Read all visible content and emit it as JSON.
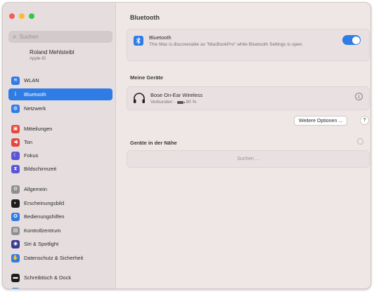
{
  "sidebar": {
    "search_placeholder": "Suchen",
    "account": {
      "name": "Roland Mehlsteibl",
      "subtitle": "Apple-ID"
    },
    "items": [
      {
        "label": "WLAN",
        "icon": "wifi-icon",
        "color": "#2f7ce6",
        "glyph": "≋"
      },
      {
        "label": "Bluetooth",
        "icon": "bluetooth-icon",
        "color": "#2f7ce6",
        "glyph": "ᛒ",
        "active": true
      },
      {
        "label": "Netzwerk",
        "icon": "globe-icon",
        "color": "#2f7ce6",
        "glyph": "◍"
      },
      {
        "label": "Mitteilungen",
        "icon": "bell-icon",
        "color": "#e5483f",
        "glyph": "▣"
      },
      {
        "label": "Ton",
        "icon": "speaker-icon",
        "color": "#e5483f",
        "glyph": "◀"
      },
      {
        "label": "Fokus",
        "icon": "moon-icon",
        "color": "#5b55d6",
        "glyph": "☾"
      },
      {
        "label": "Bildschirmzeit",
        "icon": "hourglass-icon",
        "color": "#5b55d6",
        "glyph": "⧗"
      },
      {
        "label": "Allgemein",
        "icon": "gear-icon",
        "color": "#8e8e93",
        "glyph": "⚙"
      },
      {
        "label": "Erscheinungsbild",
        "icon": "appearance-icon",
        "color": "#1c1c1e",
        "glyph": "◐"
      },
      {
        "label": "Bedienungshilfen",
        "icon": "accessibility-icon",
        "color": "#2f7ce6",
        "glyph": "✪"
      },
      {
        "label": "Kontrollzentrum",
        "icon": "control-center-icon",
        "color": "#8e8e93",
        "glyph": "▤"
      },
      {
        "label": "Siri & Spotlight",
        "icon": "siri-icon",
        "color": "#3b3b8f",
        "glyph": "◉"
      },
      {
        "label": "Datenschutz & Sicherheit",
        "icon": "hand-icon",
        "color": "#2f7ce6",
        "glyph": "✋"
      },
      {
        "label": "Schreibtisch & Dock",
        "icon": "dock-icon",
        "color": "#1c1c1e",
        "glyph": "▬"
      },
      {
        "label": "Displays",
        "icon": "display-icon",
        "color": "#2f7ce6",
        "glyph": "▭"
      }
    ]
  },
  "main": {
    "title": "Bluetooth",
    "bluetooth": {
      "title": "Bluetooth",
      "description": "This Mac is discoverable as \"MacBookPro\" while Bluetooth Settings is open.",
      "enabled": true
    },
    "my_devices_label": "Meine Geräte",
    "device": {
      "name": "Bose On-Ear Wireless",
      "status": "Verbunden · ",
      "battery": "90 %"
    },
    "more_options_label": "Weitere Optionen ...",
    "help_label": "?",
    "nearby_label": "Geräte in der Nähe",
    "nearby_status": "Suchen ..."
  },
  "colors": {
    "accent": "#2f7ce6",
    "window_bg": "#efe7e6",
    "sidebar_bg": "#e6dede"
  }
}
